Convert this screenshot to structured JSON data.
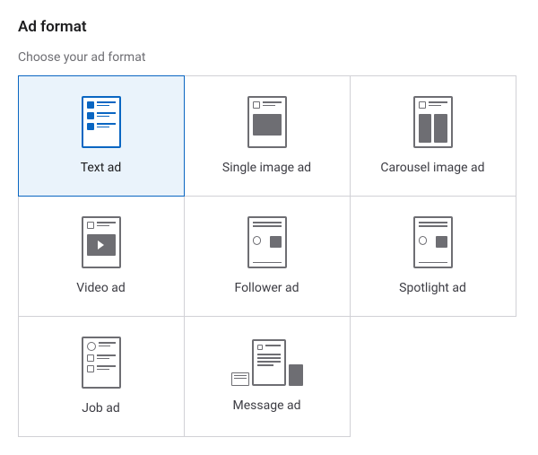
{
  "section": {
    "title": "Ad format",
    "subtitle": "Choose your ad format"
  },
  "formats": {
    "text_ad": "Text ad",
    "single_image_ad": "Single image ad",
    "carousel_image_ad": "Carousel image ad",
    "video_ad": "Video ad",
    "follower_ad": "Follower ad",
    "spotlight_ad": "Spotlight ad",
    "job_ad": "Job ad",
    "message_ad": "Message ad"
  },
  "selected": "text_ad"
}
